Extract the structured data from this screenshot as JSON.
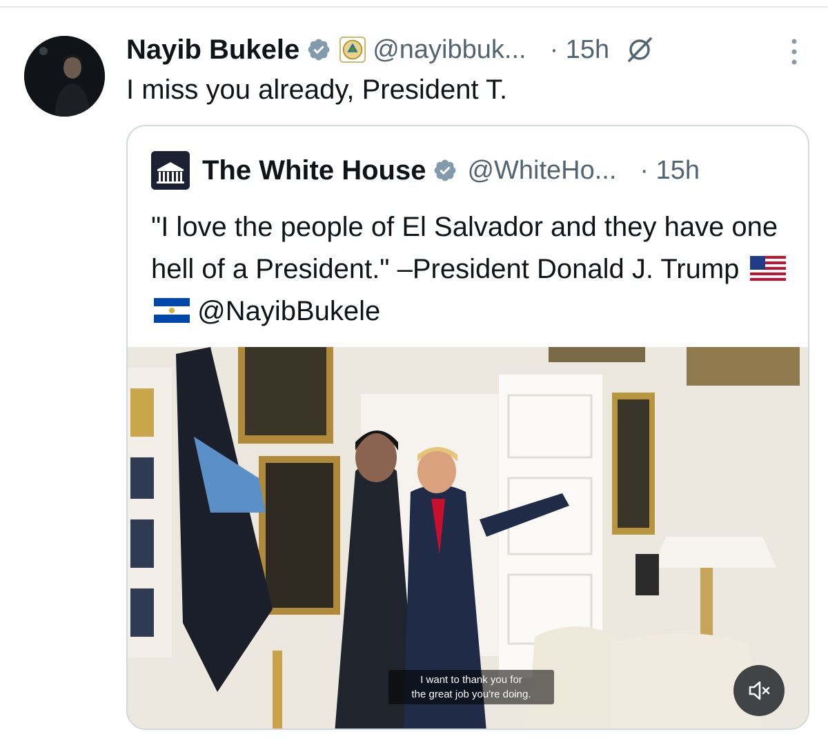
{
  "author": {
    "display_name": "Nayib Bukele",
    "handle": "@nayibbuk...",
    "time": "· 15h",
    "avatar_icon": "person-avatar",
    "verified_icon": "verified-badge-icon",
    "affiliation_icon": "el-salvador-seal-icon"
  },
  "tweet": {
    "text": "I miss you already, President T."
  },
  "quoted": {
    "display_name": "The White House",
    "handle": "@WhiteHo...",
    "time": "· 15h",
    "text_before_flags": "\"I love the people of El Salvador and they have one hell of a President.\" –President Donald J. Trump",
    "text_after_flags": "@NayibBukele",
    "video_caption_line1": "I want to thank you for",
    "video_caption_line2": "the great job you're doing."
  },
  "colors": {
    "text": "#0f1419",
    "secondary": "#536471",
    "border": "#cfd9de",
    "verified": "#829aab"
  }
}
